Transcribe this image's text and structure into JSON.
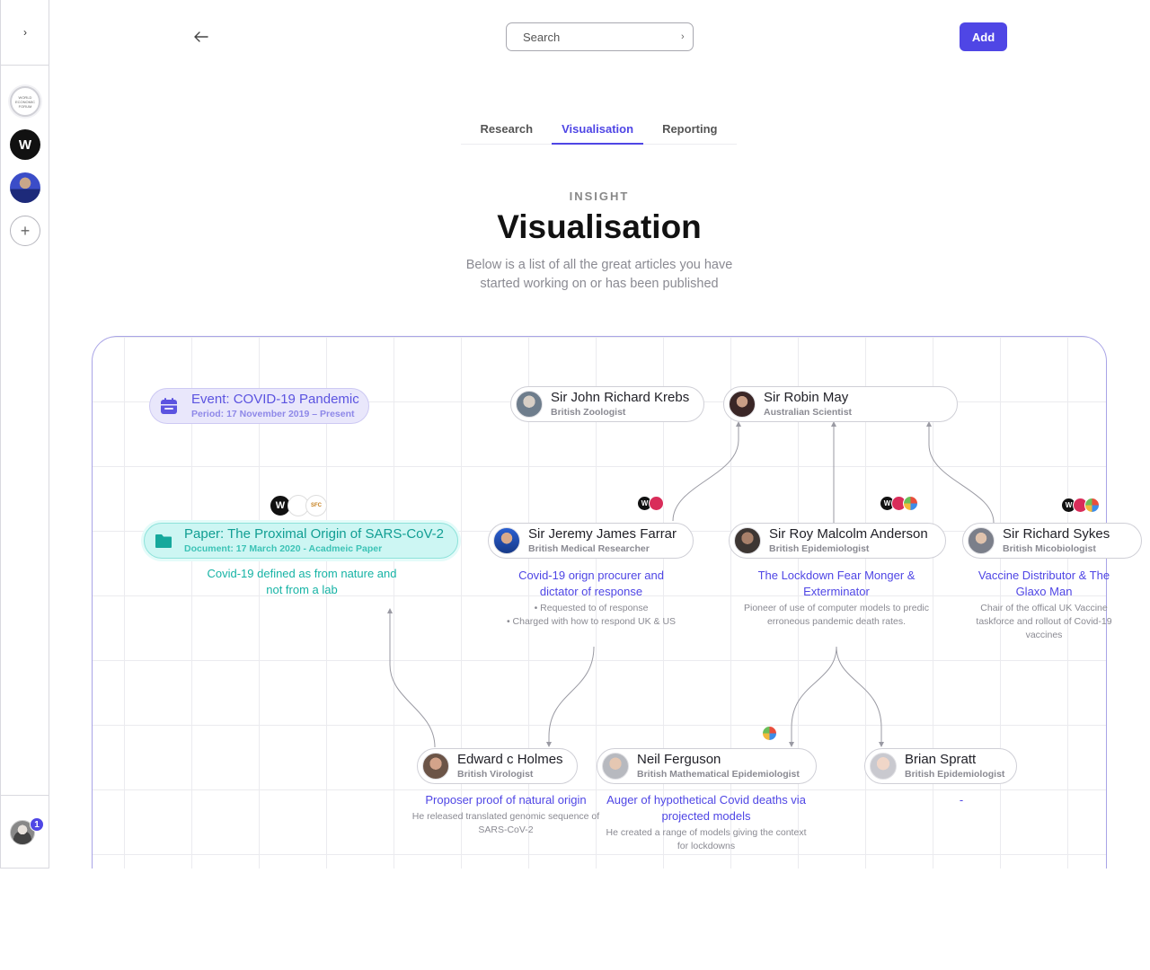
{
  "sidebar": {
    "toggle_glyph": "›",
    "workspaces": [
      {
        "name": "world-economic-forum",
        "glyph": "WORLD ECONOMIC FORUM"
      },
      {
        "name": "w-publisher",
        "glyph": "W"
      },
      {
        "name": "person"
      },
      {
        "name": "add-workspace",
        "glyph": "+"
      }
    ],
    "user": {
      "badge": "1"
    }
  },
  "topbar": {
    "search_placeholder": "Search",
    "search_go": "›",
    "add_label": "Add"
  },
  "tabs": [
    {
      "label": "Research",
      "active": false
    },
    {
      "label": "Visualisation",
      "active": true
    },
    {
      "label": "Reporting",
      "active": false
    }
  ],
  "header": {
    "eyebrow": "INSIGHT",
    "title": "Visualisation",
    "subtitle": "Below is a list of all the great articles you have started working on or has been published"
  },
  "graph": {
    "event": {
      "title": "Event: COVID-19 Pandemic",
      "meta": "Period: 17 November 2019 – Present"
    },
    "paper": {
      "title": "Paper: The Proximal Origin of SARS-CoV-2",
      "meta": "Document: 17 March 2020 - Acadmeic Paper",
      "headline": "Covid-19 defined as from nature and not from a lab",
      "publishers": [
        "W",
        "",
        "SFC"
      ]
    },
    "people": {
      "krebs": {
        "name": "Sir John Richard Krebs",
        "role": "British Zoologist"
      },
      "may": {
        "name": "Sir Robin May",
        "role": "Australian Scientist"
      },
      "farrar": {
        "name": "Sir Jeremy James Farrar",
        "role": "British Medical Researcher",
        "headline": "Covid-19 orign procurer and dictator of response",
        "notes": [
          "• Requested to of response",
          "• Charged with how to respond UK & US"
        ]
      },
      "anderson": {
        "name": "Sir Roy Malcolm Anderson",
        "role": "British Epidemiologist",
        "headline": "The Lockdown Fear Monger & Exterminator",
        "body": "Pioneer of use of computer models to predic erroneous pandemic death rates."
      },
      "sykes": {
        "name": "Sir Richard Sykes",
        "role": "British Micobiologist",
        "headline": "Vaccine Distributor & The Glaxo Man",
        "body": "Chair of the offical UK Vaccine taskforce and rollout of Covid-19 vaccines"
      },
      "holmes": {
        "name": "Edward c Holmes",
        "role": "British Virologist",
        "headline": "Proposer proof of natural origin",
        "body": "He released translated genomic sequence of SARS-CoV-2"
      },
      "ferguson": {
        "name": "Neil Ferguson",
        "role": "British Mathematical Epidemiologist",
        "headline": "Auger of hypothetical Covid deaths via projected models",
        "body": "He created a range of models giving the context for lockdowns"
      },
      "spratt": {
        "name": "Brian Spratt",
        "role": "British Epidemiologist",
        "headline": "-"
      }
    }
  },
  "colors": {
    "accent": "#4f46e5",
    "teal": "#16b3a5",
    "event_bg": "#e9e7fb",
    "paper_bg": "#cdf6f3"
  }
}
